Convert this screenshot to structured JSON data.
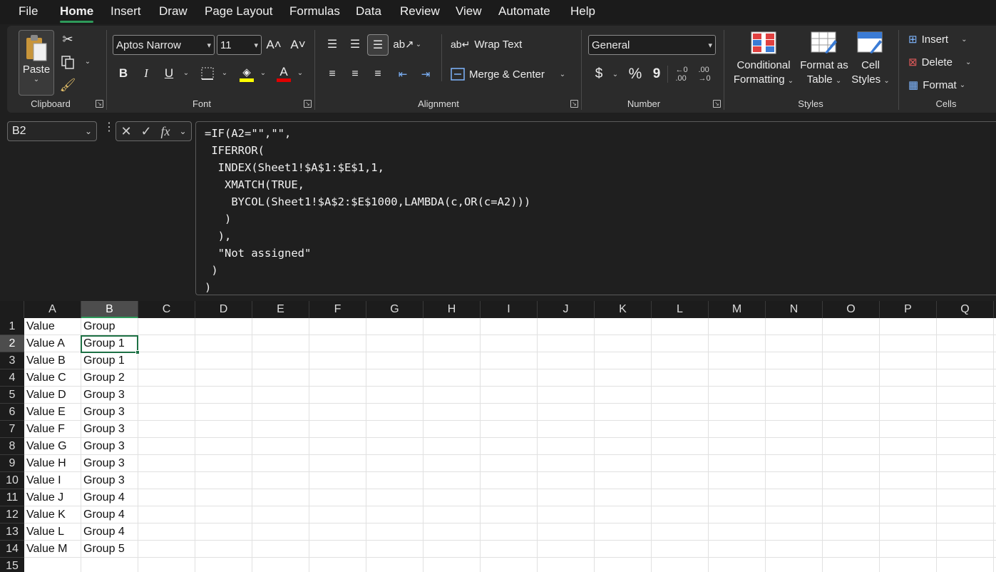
{
  "menu": [
    "File",
    "Home",
    "Insert",
    "Draw",
    "Page Layout",
    "Formulas",
    "Data",
    "Review",
    "View",
    "Automate",
    "Help"
  ],
  "active_tab": "Home",
  "ribbon": {
    "clipboard": {
      "paste": "Paste",
      "label": "Clipboard"
    },
    "font": {
      "name": "Aptos Narrow",
      "size": "11",
      "label": "Font",
      "bold": "B",
      "italic": "I",
      "underline": "U"
    },
    "alignment": {
      "wrap_text": "Wrap Text",
      "merge_center": "Merge & Center",
      "label": "Alignment"
    },
    "number": {
      "format": "General",
      "label": "Number",
      "currency": "$",
      "percent": "%",
      "comma": "9"
    },
    "styles": {
      "conditional": [
        "Conditional",
        "Formatting"
      ],
      "format_table": [
        "Format as",
        "Table"
      ],
      "cell_styles": [
        "Cell",
        "Styles"
      ],
      "label": "Styles"
    },
    "cells": {
      "insert": "Insert",
      "delete": "Delete",
      "format": "Format",
      "label": "Cells"
    }
  },
  "formula_bar": {
    "name_box": "B2",
    "fx": "fx",
    "formula_lines": [
      "=IF(A2=\"\",\"\",",
      " IFERROR(",
      "  INDEX(Sheet1!$A$1:$E$1,1,",
      "   XMATCH(TRUE,",
      "    BYCOL(Sheet1!$A$2:$E$1000,LAMBDA(c,OR(c=A2)))",
      "   )",
      "  ),",
      "  \"Not assigned\"",
      " )",
      ")"
    ]
  },
  "sheet": {
    "columns": [
      "A",
      "B",
      "C",
      "D",
      "E",
      "F",
      "G",
      "H",
      "I",
      "J",
      "K",
      "L",
      "M",
      "N",
      "O",
      "P",
      "Q"
    ],
    "selected_column": "B",
    "selected_row": "2",
    "rows": [
      [
        "1",
        "Value",
        "Group"
      ],
      [
        "2",
        "Value A",
        "Group 1"
      ],
      [
        "3",
        "Value B",
        "Group 1"
      ],
      [
        "4",
        "Value C",
        "Group 2"
      ],
      [
        "5",
        "Value D",
        "Group 3"
      ],
      [
        "6",
        "Value E",
        "Group 3"
      ],
      [
        "7",
        "Value F",
        "Group 3"
      ],
      [
        "8",
        "Value G",
        "Group 3"
      ],
      [
        "9",
        "Value H",
        "Group 3"
      ],
      [
        "10",
        "Value I",
        "Group 3"
      ],
      [
        "11",
        "Value J",
        "Group 4"
      ],
      [
        "12",
        "Value K",
        "Group 4"
      ],
      [
        "13",
        "Value L",
        "Group 4"
      ],
      [
        "14",
        "Value M",
        "Group 5"
      ],
      [
        "15",
        "",
        ""
      ]
    ]
  },
  "colors": {
    "accent_green": "#1e7145",
    "highlight_yellow": "#ffff00",
    "font_red": "#e00000"
  }
}
